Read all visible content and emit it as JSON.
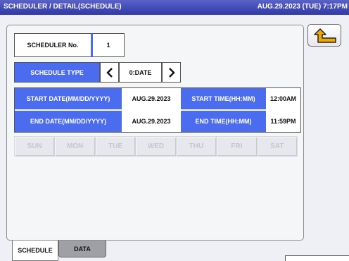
{
  "header": {
    "title": "SCHEDULER / DETAIL(SCHEDULE)",
    "datetime": "AUG.29.2023 (TUE)  7:17PM"
  },
  "scheduler_no": {
    "label": "SCHEDULER No.",
    "value": "1"
  },
  "schedule_type": {
    "label": "SCHEDULE TYPE",
    "value": "0:DATE",
    "prev_icon": "chevron-left",
    "next_icon": "chevron-right"
  },
  "start": {
    "date_label": "START DATE(MM/DD/YYYY)",
    "date_value": "AUG.29.2023",
    "time_label": "START TIME(HH:MM)",
    "time_value": "12:00AM"
  },
  "end": {
    "date_label": "END DATE(MM/DD/YYYY)",
    "date_value": "AUG.29.2023",
    "time_label": "END TIME(HH:MM)",
    "time_value": "11:59PM"
  },
  "weekdays": [
    "SUN",
    "MON",
    "TUE",
    "WED",
    "THU",
    "FRI",
    "SAT"
  ],
  "tabs": {
    "schedule": "SCHEDULE",
    "data": "DATA"
  },
  "back_icon": "return-arrow",
  "colors": {
    "title_bar": "#3a42b4",
    "label_blue": "#4c6cf0",
    "back_arrow": "#f0a800"
  }
}
